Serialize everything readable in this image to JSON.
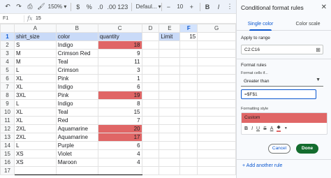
{
  "toolbar": {
    "zoom": "150%",
    "font": "Defaul...",
    "font_size": "10"
  },
  "formula_bar": {
    "cell_ref": "F1",
    "fx": "fx",
    "content": "15"
  },
  "columns": [
    "A",
    "B",
    "C",
    "D",
    "E",
    "F",
    "G"
  ],
  "rows": [
    {
      "num": "1",
      "a": "shirt_size",
      "b": "color",
      "c": "quantity",
      "e": "Limit",
      "f": "15"
    },
    {
      "num": "2",
      "a": "S",
      "b": "Indigo",
      "c": "18",
      "hl": true
    },
    {
      "num": "3",
      "a": "M",
      "b": "Crimson Red",
      "c": "9",
      "hl": false
    },
    {
      "num": "4",
      "a": "M",
      "b": "Teal",
      "c": "11",
      "hl": false
    },
    {
      "num": "5",
      "a": "L",
      "b": "Crimson",
      "c": "3",
      "hl": false
    },
    {
      "num": "6",
      "a": "XL",
      "b": "Pink",
      "c": "1",
      "hl": false
    },
    {
      "num": "7",
      "a": "XL",
      "b": "Indigo",
      "c": "6",
      "hl": false
    },
    {
      "num": "8",
      "a": "3XL",
      "b": "Pink",
      "c": "19",
      "hl": true
    },
    {
      "num": "9",
      "a": "L",
      "b": "Indigo",
      "c": "8",
      "hl": false
    },
    {
      "num": "10",
      "a": "XL",
      "b": "Teal",
      "c": "15",
      "hl": false
    },
    {
      "num": "11",
      "a": "XL",
      "b": "Red",
      "c": "7",
      "hl": false
    },
    {
      "num": "12",
      "a": "2XL",
      "b": "Aquamarine",
      "c": "20",
      "hl": true
    },
    {
      "num": "13",
      "a": "2XL",
      "b": "Aquamarine",
      "c": "17",
      "hl": true
    },
    {
      "num": "14",
      "a": "L",
      "b": "Purple",
      "c": "6",
      "hl": false
    },
    {
      "num": "15",
      "a": "XS",
      "b": "Violet",
      "c": "4",
      "hl": false
    },
    {
      "num": "16",
      "a": "XS",
      "b": "Maroon",
      "c": "4",
      "hl": false
    },
    {
      "num": "17",
      "a": "",
      "b": "",
      "c": "",
      "hl": false
    }
  ],
  "panel": {
    "title": "Conditional format rules",
    "tabs": [
      "Single color",
      "Color scale"
    ],
    "apply_label": "Apply to range",
    "range": "C2:C16",
    "rules_label": "Format rules",
    "cells_if_label": "Format cells if...",
    "condition": "Greater than",
    "value": "=$F$1",
    "style_label": "Formatting style",
    "style_name": "Custom",
    "cancel": "Cancel",
    "done": "Done",
    "add_rule": "+ Add another rule"
  },
  "colors": {
    "highlight": "#e06666",
    "header_fill": "#c9daf8",
    "accent": "#0b57d0",
    "done_green": "#146c2e"
  }
}
